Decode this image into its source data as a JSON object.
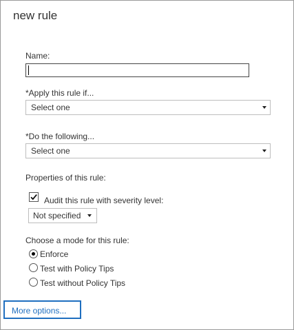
{
  "dialog": {
    "title": "new rule"
  },
  "form": {
    "name_label": "Name:",
    "name_value": "",
    "apply_label": "*Apply this rule if...",
    "apply_selected": "Select one",
    "do_label": "*Do the following...",
    "do_selected": "Select one",
    "properties_label": "Properties of this rule:",
    "audit_label": "Audit this rule with severity level:",
    "audit_checked": true,
    "severity_selected": "Not specified",
    "mode_label": "Choose a mode for this rule:",
    "modes": [
      {
        "label": "Enforce",
        "selected": true
      },
      {
        "label": "Test with Policy Tips",
        "selected": false
      },
      {
        "label": "Test without Policy Tips",
        "selected": false
      }
    ]
  },
  "footer": {
    "more_options_label": "More options..."
  },
  "colors": {
    "link": "#1e6ebf",
    "border": "#9a9a9a"
  },
  "icons": [
    "check-icon",
    "dropdown-arrow-icon",
    "radio-dot-icon"
  ]
}
